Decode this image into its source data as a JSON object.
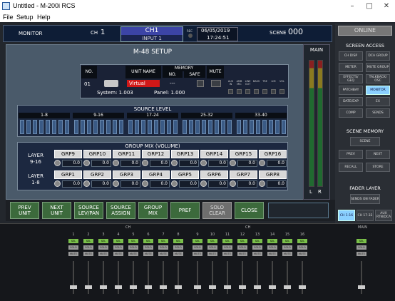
{
  "window": {
    "title": "Untitled - M-200i RCS"
  },
  "menu": [
    "File",
    "Setup",
    "Help"
  ],
  "header": {
    "monitor": "MONITOR",
    "ch_label": "CH",
    "ch_number": "1",
    "ch_name": "CH1",
    "ch_input": "INPUT 1",
    "rec": "REC",
    "date": "06/05/2019",
    "time": "17:24:51",
    "scene_label": "SCENE",
    "scene_number": "000"
  },
  "setup": {
    "title": "M-48 SETUP",
    "table_headers": {
      "no": "NO.",
      "unit_name": "UNIT NAME",
      "memory": "MEMORY",
      "mem_no": "NO.",
      "safe": "SAFE",
      "mute": "MUTE"
    },
    "row": {
      "no": "01",
      "unit_name": "Virtual",
      "memory": "---"
    },
    "system": "System: 1.003",
    "panel": "Panel: 1.000",
    "indicators": [
      "AUX IN",
      "AMB MIC",
      "LINE OUT",
      "BASS",
      "TRE",
      "LIM",
      "VOL"
    ],
    "source_level": {
      "title": "SOURCE LEVEL",
      "ranges": [
        "1-8",
        "9-16",
        "17-24",
        "25-32",
        "33-40"
      ]
    },
    "group_mix": {
      "title": "GROUP MIX (VOLUME)",
      "layer_upper": "LAYER\n9-16",
      "layer_lower": "LAYER\n1-8",
      "upper": [
        {
          "name": "GRP9",
          "value": "0.0"
        },
        {
          "name": "GRP10",
          "value": "0.0"
        },
        {
          "name": "GRP11",
          "value": "0.0"
        },
        {
          "name": "GRP12",
          "value": "0.0"
        },
        {
          "name": "GRP13",
          "value": "0.0"
        },
        {
          "name": "GRP14",
          "value": "0.0"
        },
        {
          "name": "GRP15",
          "value": "0.0"
        },
        {
          "name": "GRP16",
          "value": "0.0"
        }
      ],
      "lower": [
        {
          "name": "GRP1",
          "value": "0.0"
        },
        {
          "name": "GRP2",
          "value": "0.0"
        },
        {
          "name": "GRP3",
          "value": "0.0"
        },
        {
          "name": "GRP4",
          "value": "0.0"
        },
        {
          "name": "GRP5",
          "value": "0.0"
        },
        {
          "name": "GRP6",
          "value": "0.0"
        },
        {
          "name": "GRP7",
          "value": "0.0"
        },
        {
          "name": "GRP8",
          "value": "0.0"
        }
      ]
    }
  },
  "func_buttons": [
    {
      "label": "PREV\nUNIT",
      "disabled": false
    },
    {
      "label": "NEXT\nUNIT",
      "disabled": false
    },
    {
      "label": "SOURCE\nLEV/PAN",
      "disabled": false
    },
    {
      "label": "SOURCE\nASSIGN",
      "disabled": false
    },
    {
      "label": "GROUP\nMIX",
      "disabled": false
    },
    {
      "label": "PREF",
      "disabled": false
    },
    {
      "label": "SOLO\nCLEAR",
      "disabled": true
    },
    {
      "label": "CLOSE",
      "disabled": false
    }
  ],
  "main_meter": {
    "label": "MAIN",
    "l": "L",
    "r": "R"
  },
  "right_panel": {
    "online": "ONLINE",
    "screen_access_title": "SCREEN ACCESS",
    "screen_access": [
      "CH DISP",
      "DCA GROUP",
      "METER",
      "MUTE GROUP",
      "EFFECTS/ GEQ",
      "TALKBACK/ OSC",
      "PATCHBAY",
      "MONITOR",
      "DATE/EXP",
      "EX",
      "COMP",
      "SENDS"
    ],
    "active_screen": "MONITOR",
    "scene_memory_title": "SCENE MEMORY",
    "scene_memory": [
      "SCENE",
      "PREV",
      "NEXT",
      "RECALL",
      "STORE"
    ],
    "fader_layer_title": "FADER LAYER",
    "sends_on_fader": "SENDS ON FADER",
    "layers": [
      "CH 1-16",
      "CH 17-32",
      "AUX RTN/DCA"
    ]
  },
  "mixer": {
    "ch_label": "CH",
    "main_label": "MAIN",
    "channels": [
      "1",
      "2",
      "3",
      "4",
      "5",
      "6",
      "7",
      "8",
      "9",
      "10",
      "11",
      "12",
      "13",
      "14",
      "15",
      "16"
    ],
    "sel": "SEL",
    "solo": "SOLO",
    "mute": "MUTE"
  }
}
